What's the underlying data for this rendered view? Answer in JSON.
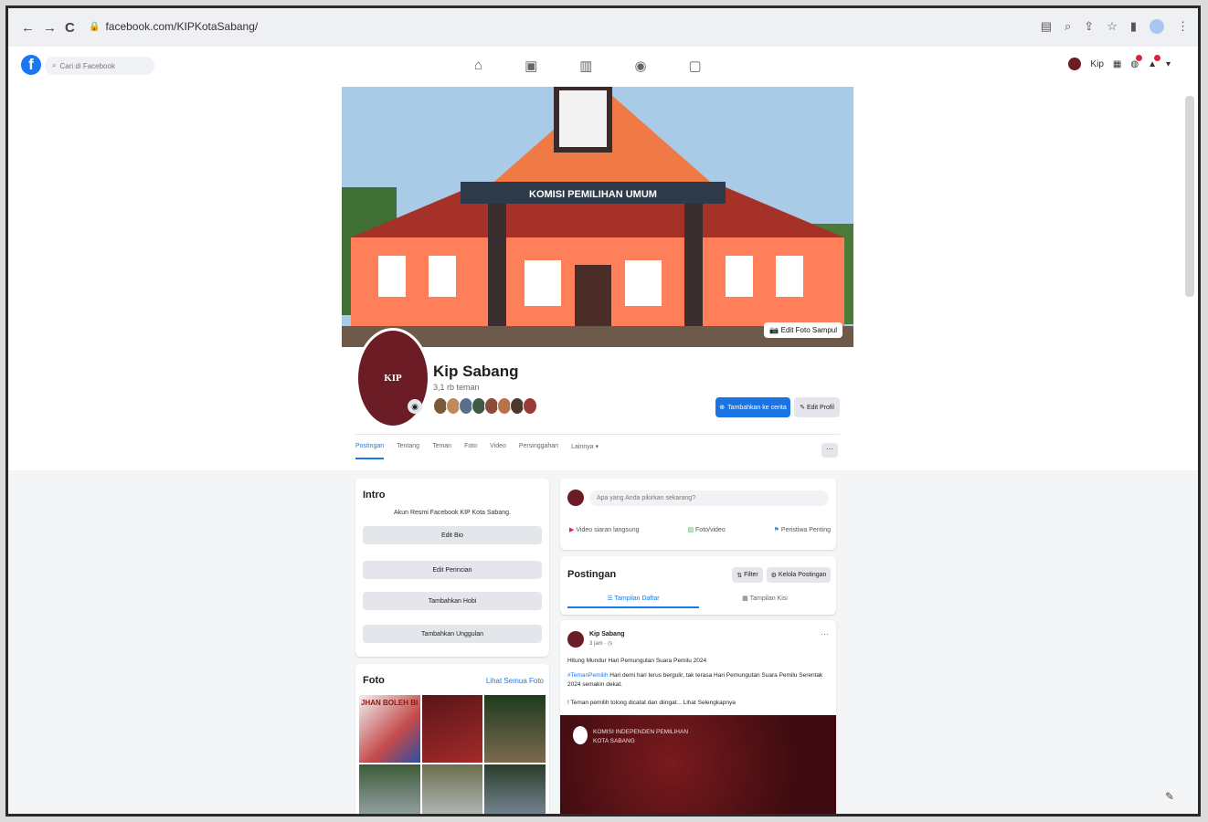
{
  "browser": {
    "url": "facebook.com/KIPKotaSabang/",
    "back_glyph": "←",
    "forward_glyph": "→",
    "reload_glyph": "C"
  },
  "fb_header": {
    "logo_letter": "f",
    "search_placeholder": "Cari di Facebook",
    "account_label": "Kip"
  },
  "cover": {
    "building_sign": "KOMISI PEMILIHAN UMUM",
    "edit_cover_label": "Edit Foto Sampul"
  },
  "profile": {
    "name": "Kip Sabang",
    "friends_count": "3,1 rb teman",
    "logo_text": "KIP",
    "add_story_label": "Tambahkan ke cerita",
    "edit_profile_label": "Edit Profil"
  },
  "tabs": [
    {
      "label": "Postingan",
      "active": true
    },
    {
      "label": "Tentang",
      "active": false
    },
    {
      "label": "Teman",
      "active": false
    },
    {
      "label": "Foto",
      "active": false
    },
    {
      "label": "Video",
      "active": false
    },
    {
      "label": "Persinggahan",
      "active": false
    },
    {
      "label": "Lainnya ▾",
      "active": false
    }
  ],
  "more_label": "···",
  "intro": {
    "title": "Intro",
    "bio": "Akun Resmi Facebook KIP Kota Sabang.",
    "buttons": [
      "Edit Bio",
      "Edit Perincian",
      "Tambahkan Hobi",
      "Tambahkan Unggulan"
    ]
  },
  "foto": {
    "title": "Foto",
    "see_all": "Lihat Semua Foto",
    "thumb1_text": "JHAN BOLEH BI"
  },
  "composer": {
    "placeholder": "Apa yang Anda pikirkan sekarang?",
    "live_video": "Video siaran langsung",
    "photo_video": "Foto/video",
    "life_event": "Peristiwa Penting"
  },
  "postings": {
    "title": "Postingan",
    "filter_label": "Filter",
    "manage_label": "Kelola Postingan",
    "list_view": "Tampilan Daftar",
    "grid_view": "Tampilan Kisi"
  },
  "post": {
    "author": "Kip Sabang",
    "time": "3 jam · ◷",
    "line1": "Hitung Mundur Hari Pemungutan Suara Pemilu 2024",
    "hashtag": "#TemanPemilih",
    "line2": " Hari demi hari terus bergulir, tak terasa Hari Pemungutan Suara Pemilu Serentak 2024 semakin dekat.",
    "line3": "! Teman pemilih tolong dicatat dan diingat... Lihat Selengkapnya",
    "image_title": "KOMISI INDEPENDEN PEMILIHAN",
    "image_subtitle": "KOTA SABANG"
  },
  "colors": {
    "fb_blue": "#1877f2",
    "kip_maroon": "#6b1c24"
  }
}
